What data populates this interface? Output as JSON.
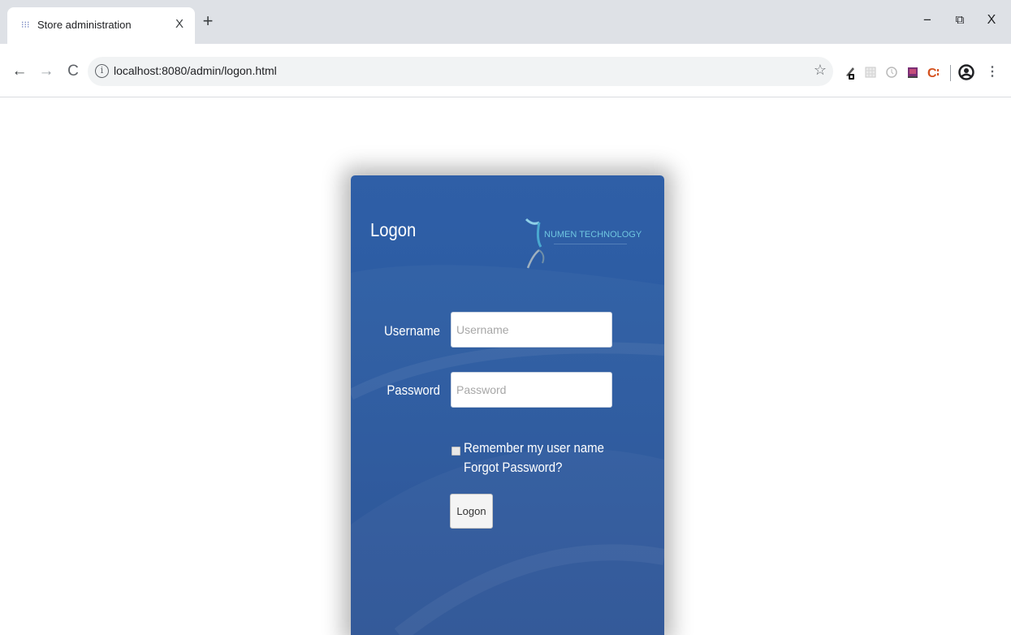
{
  "browser": {
    "tab_title": "Store administration",
    "tab_close": "X",
    "new_tab": "+",
    "window_minimize": "−",
    "window_restore": "⧉",
    "window_close": "X",
    "url": "localhost:8080/admin/logon.html",
    "nav_back": "←",
    "nav_forward": "→",
    "nav_reload": "C"
  },
  "login": {
    "title": "Logon",
    "brand_name": "NUMEN TECHNOLOGY",
    "username_label": "Username",
    "username_placeholder": "Username",
    "username_value": "",
    "password_label": "Password",
    "password_placeholder": "Password",
    "password_value": "",
    "remember_label": "Remember my user name",
    "remember_checked": false,
    "forgot_label": "Forgot Password?",
    "submit_label": "Logon"
  },
  "colors": {
    "panel_blue": "#2c5ca3",
    "brand_cyan": "#6fc6e0",
    "chrome_gray": "#dee1e6"
  }
}
